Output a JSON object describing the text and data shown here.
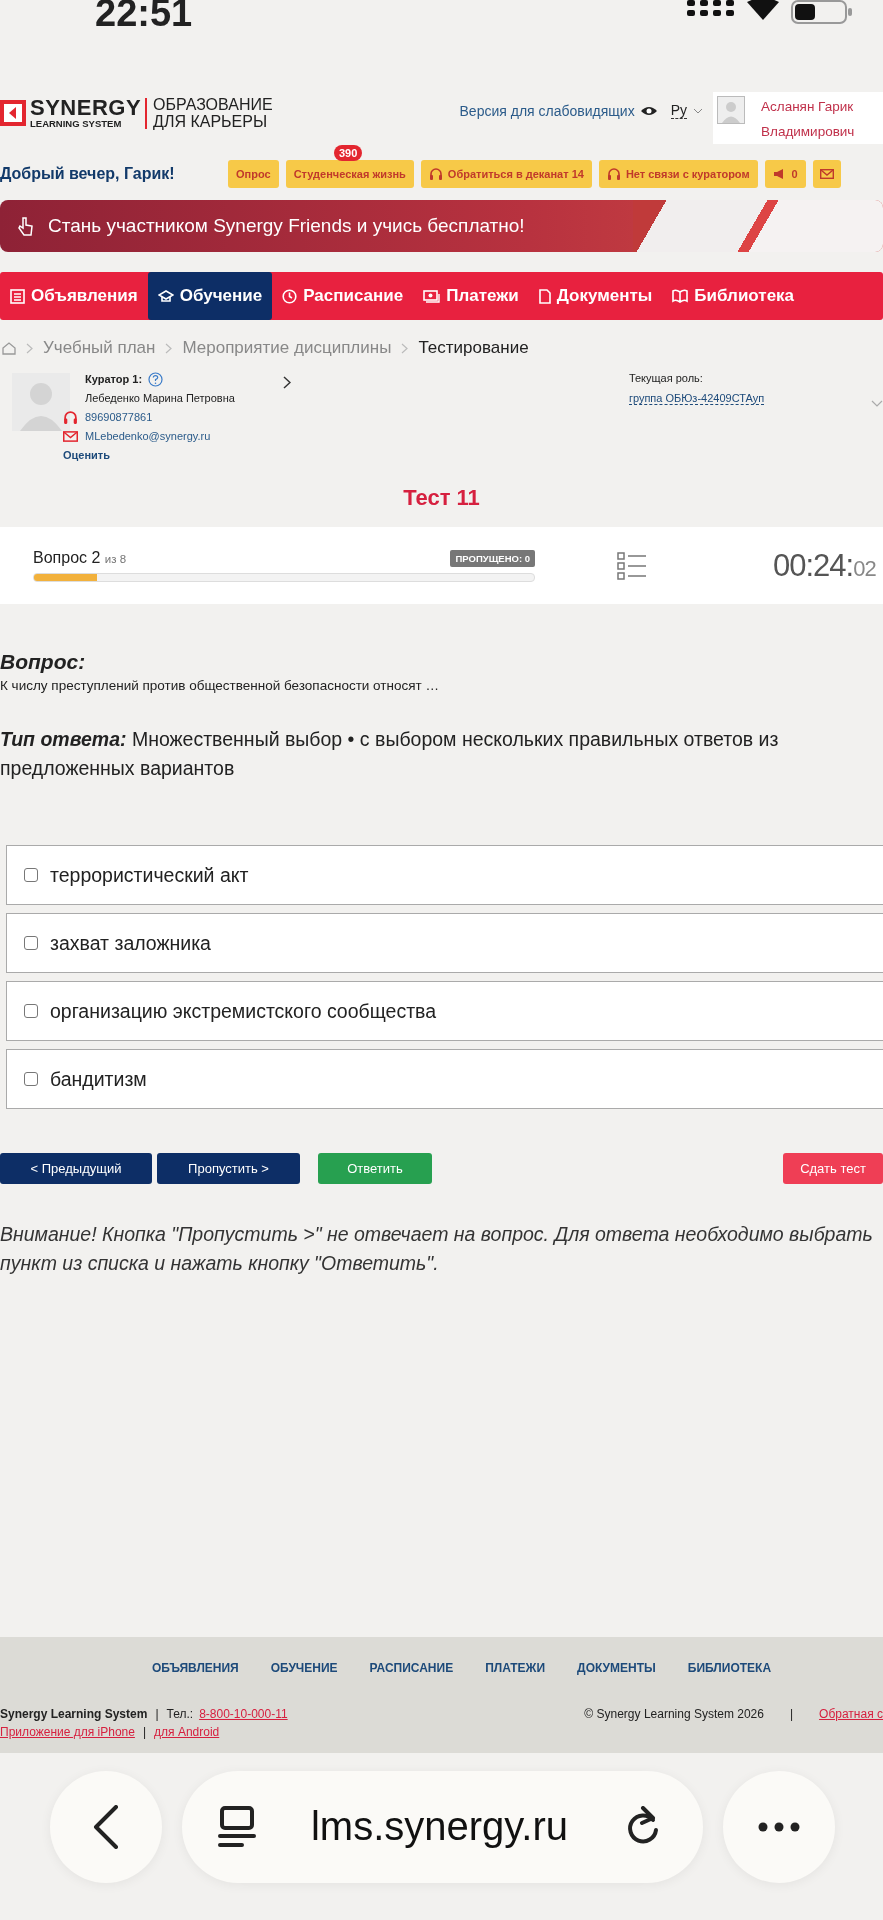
{
  "status_bar": {
    "time": "22:51"
  },
  "header": {
    "logo": {
      "brand": "SYNERGY",
      "brand_sub": "LEARNING SYSTEM",
      "tagline_1": "ОБРАЗОВАНИЕ",
      "tagline_2": "ДЛЯ КАРЬЕРЫ"
    },
    "accessibility_link": "Версия для слабовидящих",
    "language": "Ру",
    "user_name": "Асланян Гарик Владимирович"
  },
  "greeting": "Добрый вечер, Гарик!",
  "quick_buttons": [
    {
      "kind": "text",
      "label": "Опрос"
    },
    {
      "kind": "text",
      "label": "Студенческая жизнь",
      "badge": "390"
    },
    {
      "kind": "headset",
      "label": "Обратиться в деканат 14"
    },
    {
      "kind": "headset",
      "label": "Нет связи с куратором"
    },
    {
      "kind": "megaphone",
      "label": "0"
    },
    {
      "kind": "mail"
    }
  ],
  "banner": {
    "text": "Стань участником Synergy Friends и учись бесплатно!"
  },
  "nav": [
    {
      "label": "Объявления",
      "selected": false
    },
    {
      "label": "Обучение",
      "selected": true
    },
    {
      "label": "Расписание",
      "selected": false
    },
    {
      "label": "Платежи",
      "selected": false
    },
    {
      "label": "Документы",
      "selected": false
    },
    {
      "label": "Библиотека",
      "selected": false
    }
  ],
  "breadcrumb": [
    "Учебный план",
    "Мероприятие дисциплины",
    "Тестирование"
  ],
  "curator": {
    "label": "Куратор 1:",
    "name": "Лебеденко Марина Петровна",
    "phone": "89690877861",
    "email": "MLebedenko@synergy.ru",
    "rate": "Оценить",
    "role_label": "Текущая роль:",
    "role": "группа ОБЮз-42409СТАуп"
  },
  "test": {
    "title": "Тест 11",
    "question_label": "Вопрос 2",
    "question_of": "из 8",
    "skipped": "ПРОПУЩЕНО: 0",
    "level": 0.125,
    "timer": "00:24:",
    "timer_seconds": "02"
  },
  "question": {
    "heading": "Вопрос:",
    "text": "К числу преступлений против общественной безопасности относят …"
  },
  "answer_type": {
    "label": "Тип ответа:",
    "text": "Множественный выбор • с выбором нескольких правильных ответов из предложенных вариантов"
  },
  "answers": [
    {
      "text": "террористический акт",
      "checked": false
    },
    {
      "text": "захват заложника",
      "checked": false
    },
    {
      "text": "организацию экстремистского сообщества",
      "checked": false
    },
    {
      "text": "бандитизм",
      "checked": false
    }
  ],
  "buttons": [
    {
      "kind": "nav",
      "label": "< Предыдущий"
    },
    {
      "kind": "nav",
      "label": "Пропустить >"
    },
    {
      "kind": "answer",
      "label": "Ответить"
    },
    {
      "kind": "finish",
      "label": "Сдать тест"
    }
  ],
  "notice": "Внимание! Кнопка \"Пропустить >\" не отвечает на вопрос. Для ответа необходимо выбрать пункт из списка и нажать кнопку \"Ответить\".",
  "footer": {
    "links": [
      "ОБЪЯВЛЕНИЯ",
      "ОБУЧЕНИЕ",
      "РАСПИСАНИЕ",
      "ПЛАТЕЖИ",
      "ДОКУМЕНТЫ",
      "БИБЛИОТЕКА"
    ],
    "company": "Synergy Learning System",
    "phone_label": "Тел.:",
    "phone": "8-800-10-000-11",
    "copyright": "© Synergy Learning System 2026",
    "feedback": "Обратная с",
    "app_iphone": "Приложение для iPhone",
    "app_android": "для Android",
    "separators": [
      "|",
      "|",
      "|"
    ]
  },
  "browser": {
    "url": "lms.synergy.ru"
  }
}
